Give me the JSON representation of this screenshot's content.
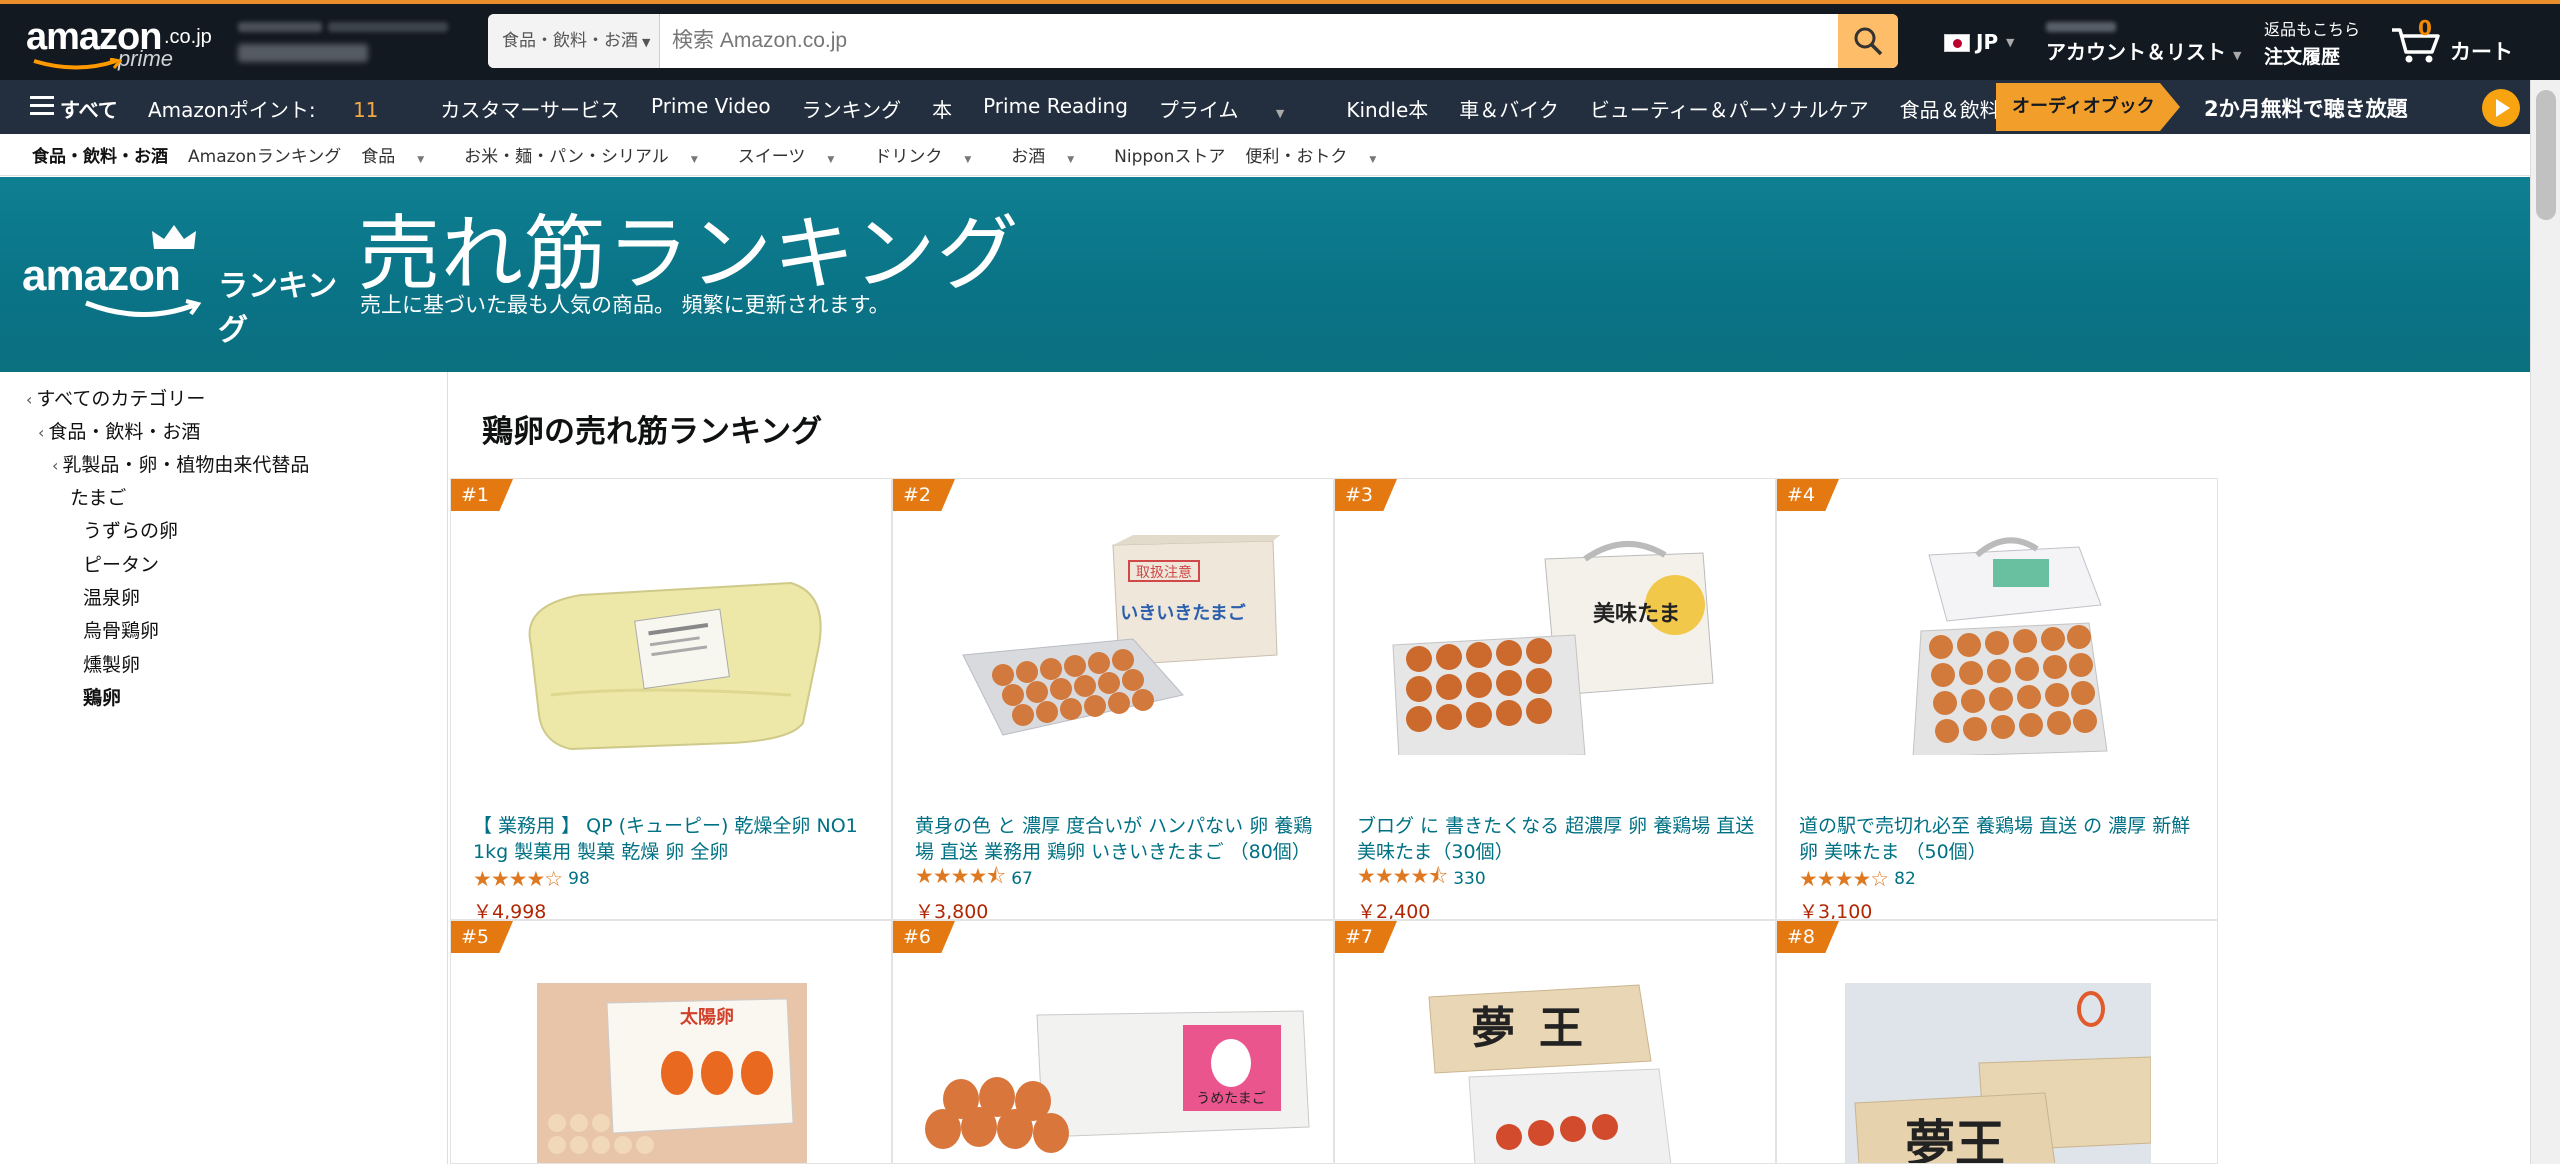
{
  "header": {
    "logo_word": "amazon",
    "logo_tld": ".co.jp",
    "logo_sub": "prime",
    "search": {
      "category": "食品・飲料・お酒",
      "placeholder": "検索 Amazon.co.jp"
    },
    "language": "JP",
    "account_label": "アカウント＆リスト",
    "orders_small": "返品もこちら",
    "orders_main": "注文履歴",
    "cart_count": "0",
    "cart_label": "カート"
  },
  "navbar": {
    "all_label": "すべて",
    "points_label": "Amazonポイント:",
    "points_value": "11",
    "items": [
      "カスタマーサービス",
      "Prime Video",
      "ランキング",
      "本",
      "Prime Reading",
      "プライム",
      "Kindle本",
      "車＆バイク",
      "ビューティー＆パーソナルケア",
      "食品＆飲料"
    ],
    "audible_tag": "オーディオブック",
    "audible_text": "2か月無料で聴き放題"
  },
  "subnav": {
    "items": [
      "食品・飲料・お酒",
      "Amazonランキング",
      "食品",
      "お米・麺・パン・シリアル",
      "スイーツ",
      "ドリンク",
      "お酒",
      "Nipponストア",
      "便利・おトク"
    ]
  },
  "banner": {
    "logo_word": "amazon",
    "logo_ranking": "ランキング",
    "title": "売れ筋ランキング",
    "subtitle": "売上に基づいた最も人気の商品。 頻繁に更新されます。"
  },
  "sidebar": {
    "items": [
      {
        "label": "すべてのカテゴリー",
        "back": true
      },
      {
        "label": "食品・飲料・お酒",
        "back": true
      },
      {
        "label": "乳製品・卵・植物由来代替品",
        "back": true
      },
      {
        "label": "たまご"
      },
      {
        "label": "うずらの卵"
      },
      {
        "label": "ピータン"
      },
      {
        "label": "温泉卵"
      },
      {
        "label": "烏骨鶏卵"
      },
      {
        "label": "燻製卵"
      },
      {
        "label": "鶏卵",
        "selected": true
      }
    ]
  },
  "main": {
    "heading": "鶏卵の売れ筋ランキング",
    "products": [
      {
        "rank": "#1",
        "title": "【 業務用 】 QP (キューピー) 乾燥全卵 NO1 1kg 製菓用 製菓 乾燥 卵 全卵",
        "stars": 4.0,
        "reviews": "98",
        "price": "￥4,998"
      },
      {
        "rank": "#2",
        "title": "黄身の色 と 濃厚 度合いが ハンパない 卵 養鶏場 直送 業務用 鶏卵 いきいきたまご （80個）",
        "stars": 4.5,
        "reviews": "67",
        "price": "￥3,800"
      },
      {
        "rank": "#3",
        "title": "ブログ に 書きたくなる 超濃厚 卵 養鶏場 直送 美味たま（30個）",
        "stars": 4.5,
        "reviews": "330",
        "price": "￥2,400"
      },
      {
        "rank": "#4",
        "title": "道の駅で売切れ必至 養鶏場 直送 の 濃厚 新鮮 卵 美味たま （50個）",
        "stars": 4.0,
        "reviews": "82",
        "price": "￥3,100"
      },
      {
        "rank": "#5"
      },
      {
        "rank": "#6"
      },
      {
        "rank": "#7"
      },
      {
        "rank": "#8"
      }
    ],
    "box_texts": {
      "p2_tag": "取扱注意",
      "p2_name": "いきいきたまご",
      "p3_name": "美味たま",
      "p5_name": "太陽卵",
      "p6_name": "うめたまご",
      "p7_name": "夢王",
      "p8_name": "夢王"
    }
  },
  "colors": {
    "nav_dark": "#131921",
    "nav_secondary": "#232f3e",
    "search_button": "#febd69",
    "banner_teal": "#0a7386",
    "rank_badge": "#e47911",
    "link": "#007185",
    "price": "#b12704",
    "star": "#de7921"
  }
}
